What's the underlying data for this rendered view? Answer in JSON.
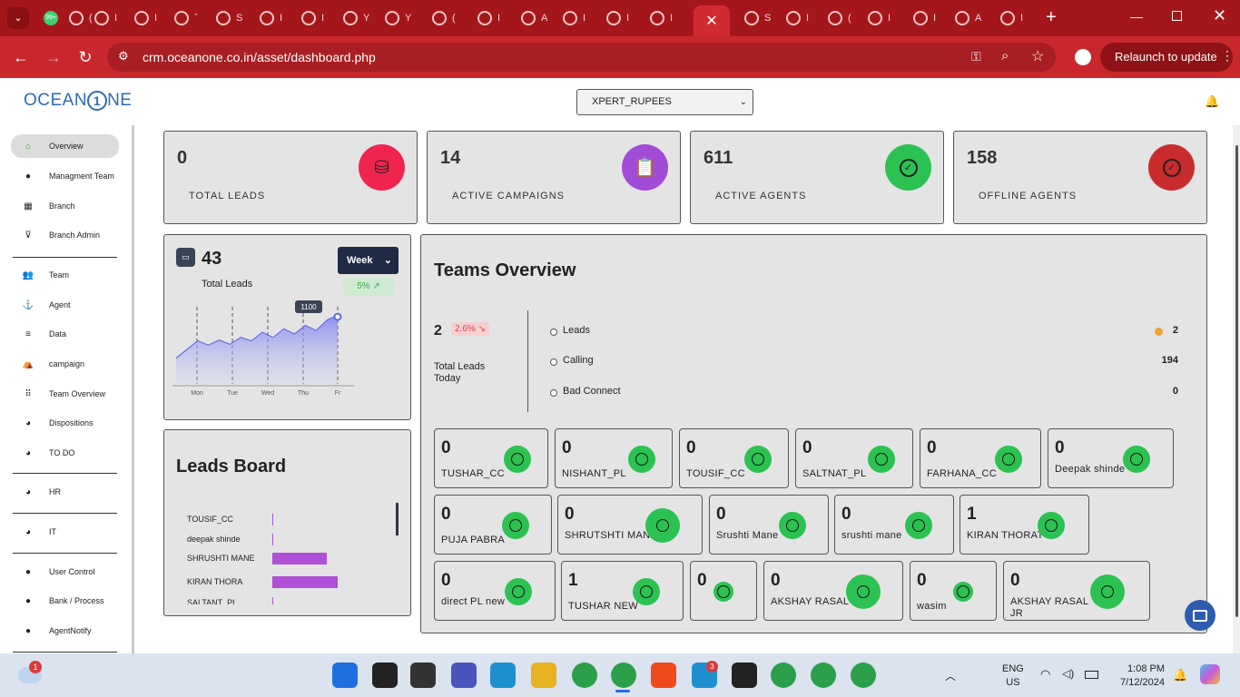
{
  "browser": {
    "url": "crm.oceanone.co.in/asset/dashboard.php",
    "relaunch_label": "Relaunch to update",
    "tab_count_badge": "99+",
    "tab_labels": [
      "(",
      "I",
      "I",
      "ˇ",
      "S",
      "I",
      "I",
      "Y",
      "Y",
      "(",
      "I",
      "A",
      "I",
      "I",
      "I",
      "S",
      "I",
      "(",
      "I",
      "I",
      "A",
      "I"
    ]
  },
  "app": {
    "logo_text_1": "OCEAN",
    "logo_one": "1",
    "logo_text_2": "NE",
    "org_select": "XPERT_RUPEES"
  },
  "sidebar": {
    "items": [
      {
        "label": "Overview",
        "icon": "home-icon"
      },
      {
        "label": "Managment Team",
        "icon": "user-icon"
      },
      {
        "label": "Branch",
        "icon": "table-icon"
      },
      {
        "label": "Branch Admin",
        "icon": "filter-icon"
      },
      {
        "label": "Team",
        "icon": "group-icon"
      },
      {
        "label": "Agent",
        "icon": "agent-icon"
      },
      {
        "label": "Data",
        "icon": "database-icon"
      },
      {
        "label": "campaign",
        "icon": "campaign-icon"
      },
      {
        "label": "Team Overview",
        "icon": "team-icon"
      },
      {
        "label": "Dispositions",
        "icon": "pie-icon"
      },
      {
        "label": "TO DO",
        "icon": "pie-icon"
      },
      {
        "label": "HR",
        "icon": "pie-icon"
      },
      {
        "label": "IT",
        "icon": "pie-icon"
      },
      {
        "label": "User Control",
        "icon": "user-icon"
      },
      {
        "label": "Bank / Process",
        "icon": "user-icon"
      },
      {
        "label": "AgentNotify",
        "icon": "user-icon"
      }
    ]
  },
  "stats": [
    {
      "value": "0",
      "label": "TOTAL LEADS",
      "color": "#f0254f",
      "icon": "coins-icon"
    },
    {
      "value": "14",
      "label": "ACTIVE CAMPAIGNS",
      "color": "#a24bd6",
      "icon": "clipboard-icon"
    },
    {
      "value": "611",
      "label": "ACTIVE AGENTS",
      "color": "#2cc253",
      "icon": "check-circle-icon"
    },
    {
      "value": "158",
      "label": "OFFLINE AGENTS",
      "color": "#c92c2c",
      "icon": "check-circle-icon"
    }
  ],
  "leads_chart": {
    "value": "43",
    "label": "Total Leads",
    "period": "Week",
    "change": "5% ↗",
    "tooltip": "1100",
    "days": [
      "Mon",
      "Tue",
      "Wed",
      "Thu",
      "Fr"
    ]
  },
  "chart_data": {
    "type": "area",
    "x": [
      "Mon",
      "Tue",
      "Wed",
      "Thu",
      "Fr"
    ],
    "series": [
      {
        "values": [
          320,
          420,
          520,
          470,
          530,
          480,
          560,
          520,
          620,
          560,
          660,
          600,
          700,
          640,
          760,
          820
        ]
      }
    ],
    "annotation": "1100"
  },
  "leads_board": {
    "title": "Leads Board",
    "rows": [
      {
        "name": "TOUSIF_CC",
        "value": 1
      },
      {
        "name": "deepak shinde",
        "value": 1
      },
      {
        "name": "SHRUSHTI MANE",
        "value": 60
      },
      {
        "name": "KIRAN THORA",
        "value": 72
      },
      {
        "name": "SALTANT_PL",
        "value": 1
      }
    ]
  },
  "teams": {
    "title": "Teams Overview",
    "total": "2",
    "total_change": "2.6% ↘",
    "total_label_1": "Total Leads",
    "total_label_2": "Today",
    "metrics": [
      {
        "label": "Leads",
        "value": "2"
      },
      {
        "label": "Calling",
        "value": "194"
      },
      {
        "label": "Bad Connect",
        "value": "0"
      }
    ],
    "members": [
      {
        "value": "0",
        "name": "TUSHAR_CC"
      },
      {
        "value": "0",
        "name": "NISHANT_PL"
      },
      {
        "value": "0",
        "name": "TOUSIF_CC"
      },
      {
        "value": "0",
        "name": "SALTNAT_PL"
      },
      {
        "value": "0",
        "name": "FARHANA_CC"
      },
      {
        "value": "0",
        "name": "Deepak shinde"
      },
      {
        "value": "0",
        "name": "PUJA PABRA"
      },
      {
        "value": "0",
        "name": "SHRUTSHTI MANE"
      },
      {
        "value": "0",
        "name": "Srushti Mane"
      },
      {
        "value": "0",
        "name": "srushti mane"
      },
      {
        "value": "1",
        "name": "KIRAN THORAT"
      },
      {
        "value": "0",
        "name": "direct PL new"
      },
      {
        "value": "1",
        "name": "TUSHAR NEW"
      },
      {
        "value": "0",
        "name": ""
      },
      {
        "value": "0",
        "name": "AKSHAY RASAL 1"
      },
      {
        "value": "0",
        "name": "wasim"
      },
      {
        "value": "0",
        "name": "AKSHAY RASAL JR"
      }
    ]
  },
  "taskbar": {
    "weather_badge": "1",
    "lang_1": "ENG",
    "lang_2": "US",
    "time": "1:08 PM",
    "date": "7/12/2024",
    "skype_badge": "3"
  }
}
